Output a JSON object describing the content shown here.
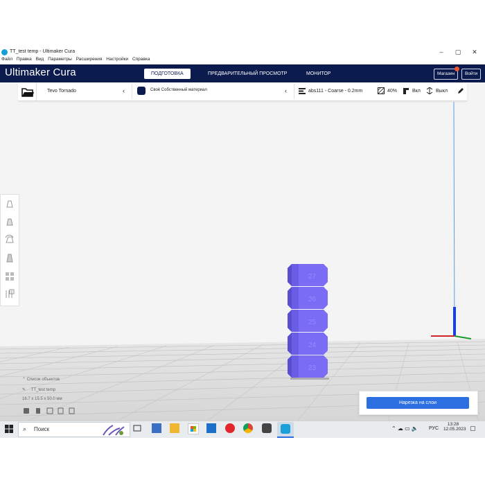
{
  "window": {
    "title": "TT_test temp - Ultimaker Cura",
    "controls": [
      "–",
      "▢",
      "✕"
    ]
  },
  "menu": [
    "Файл",
    "Правка",
    "Вид",
    "Параметры",
    "Расширения",
    "Настройки",
    "Справка"
  ],
  "header": {
    "brand": "Ultimaker Cura",
    "stages": [
      "ПОДГОТОВКА",
      "ПРЕДВАРИТЕЛЬНЫЙ ПРОСМОТР",
      "МОНИТОР"
    ],
    "active_stage": "ПОДГОТОВКА",
    "marketplace": "Магазин",
    "signin": "Войти"
  },
  "toolbar": {
    "printer": "Tevo Tornado",
    "material": "Своё Собственный материал",
    "profile": "abs111 - Coarse - 0.2mm",
    "infill": "40%",
    "support": "Вкл",
    "adhesion": "Выкл"
  },
  "objects": {
    "list_label": "Список объектов",
    "file_name": "TT_test temp",
    "dimensions": "16.7 x 15.5 x 50.0 мм"
  },
  "slice": {
    "button": "Нарезка на слои"
  },
  "taskbar": {
    "search_placeholder": "Поиск",
    "language": "РУС",
    "time": "13:28",
    "date": "12.05.2023"
  },
  "colors": {
    "header_bg": "#0c1b4d",
    "accent_blue": "#2b6fe0",
    "model_color": "#7a6cf5"
  }
}
